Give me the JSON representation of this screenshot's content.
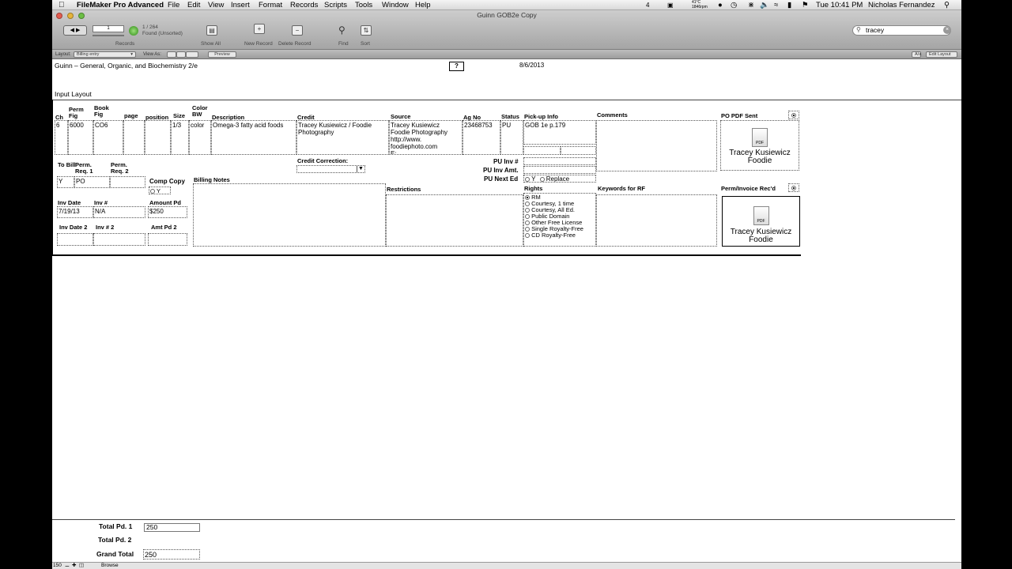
{
  "menubar": {
    "app_name": "FileMaker Pro Advanced",
    "items": [
      "File",
      "Edit",
      "View",
      "Insert",
      "Format",
      "Records",
      "Scripts",
      "Tools",
      "Window",
      "Help"
    ],
    "right": {
      "battery_temp": "41°C",
      "fan": "1846rpm",
      "num": "4",
      "clock": "Tue 10:41 PM",
      "user": "Nicholas Fernandez"
    }
  },
  "window": {
    "title": "Guinn GOB2e Copy"
  },
  "toolbar": {
    "record_number": "1",
    "record_count": "1 / 264",
    "found_status": "Found (Unsorted)",
    "records_label": "Records",
    "show_all": "Show All",
    "new_record": "New Record",
    "delete_record": "Delete Record",
    "find": "Find",
    "sort": "Sort",
    "search_value": "tracey"
  },
  "layoutbar": {
    "layout_label": "Layout:",
    "layout_value": "Billing entry",
    "view_as_label": "View As:",
    "preview": "Preview",
    "aa": "A/a",
    "edit_layout": "Edit Layout"
  },
  "header": {
    "book_title": "Guinn – General, Organic, and Biochemistry 2/e",
    "help_button": "?",
    "date": "8/6/2013",
    "layout_name": "Input Layout"
  },
  "columns": {
    "ch": "Ch",
    "perm_fig": "Perm Fig",
    "book_fig": "Book Fig",
    "page": "page",
    "position": "position",
    "size": "Size",
    "color_bw": "Color BW",
    "description": "Description",
    "credit": "Credit",
    "source": "Source",
    "ag_no": "Ag No",
    "status": "Status",
    "pickup_info": "Pick-up Info",
    "comments": "Comments",
    "po_pdf_sent": "PO PDF Sent"
  },
  "record": {
    "ch": "6",
    "perm_fig": "6000",
    "book_fig": "CO6",
    "page": "",
    "position": "",
    "size": "1/3",
    "color_bw": "color",
    "description": "Omega-3 fatty acid foods",
    "credit": "Tracey Kusiewicz / Foodie Photography",
    "source": [
      "Tracey Kusiewicz",
      "Foodie Photography",
      "http://www.",
      "foodiephoto.com",
      "E:"
    ],
    "ag_no": "23468753",
    "status": "PU",
    "pickup_info": "GOB 1e p.179"
  },
  "pdf1": {
    "name_line1": "Tracey Kusiewicz",
    "name_line2": "Foodie",
    "icon_text": "PDF"
  },
  "pdf2": {
    "name_line1": "Tracey Kusiewicz",
    "name_line2": "Foodie",
    "icon_text": "PDF"
  },
  "billing": {
    "to_bill_label": "To Bill",
    "to_bill": "Y",
    "perm_req1_label": "Perm. Req. 1",
    "perm_req1": "PO",
    "perm_req2_label": "Perm. Req. 2",
    "perm_req2": "",
    "comp_copy_label": "Comp Copy",
    "comp_copy_option": "Y",
    "billing_notes_label": "Billing Notes",
    "credit_correction_label": "Credit Correction:",
    "pu_inv_label": "PU Inv #",
    "pu_inv_amt_label": "PU Inv Amt.",
    "pu_next_ed_label": "PU Next Ed",
    "pu_next_ed_y": "Y",
    "pu_next_ed_replace": "Replace",
    "inv_date_label": "Inv Date",
    "inv_date": "7/19/13",
    "inv_no_label": "Inv #",
    "inv_no": "N/A",
    "amount_pd_label": "Amount Pd",
    "amount_pd": "$250",
    "inv_date2_label": "Inv Date 2",
    "inv_no2_label": "Inv # 2",
    "amt_pd2_label": "Amt Pd 2",
    "restrictions_label": "Restrictions",
    "rights_label": "Rights",
    "rights_options": [
      "RM",
      "Courtesy, 1 time",
      "Courtesy, All Ed.",
      "Public Domain",
      "Other Free License",
      "Single Royalty-Free",
      "CD Royalty-Free"
    ],
    "keywords_label": "Keywords for RF",
    "perm_invoice_label": "Perm/Invoice Rec'd"
  },
  "footer": {
    "total_pd1_label": "Total Pd. 1",
    "total_pd1": "250",
    "total_pd2_label": "Total Pd. 2",
    "grand_total_label": "Grand Total",
    "grand_total": "250"
  },
  "statusbar": {
    "zoom": "150",
    "mode": "Browse"
  }
}
